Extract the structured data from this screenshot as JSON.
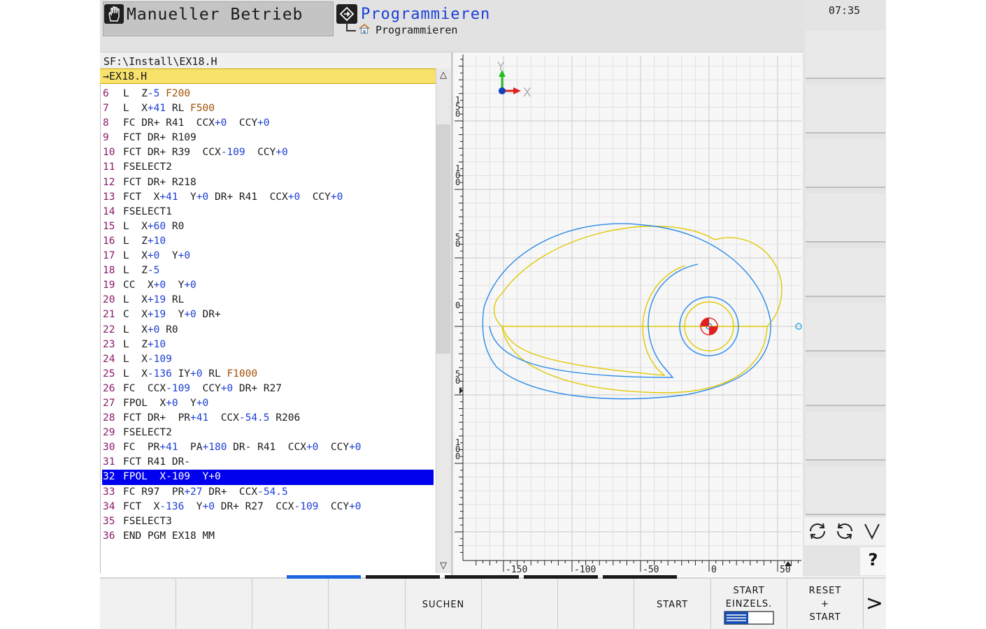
{
  "header": {
    "manual_mode": "Manueller Betrieb",
    "program_mode": "Programmieren",
    "program_submode": "Programmieren"
  },
  "clock": "07:35",
  "editor": {
    "path": "SF:\\Install\\EX18.H",
    "file": "→EX18.H",
    "lines": [
      {
        "no": "6",
        "text": "L  Z-5 F200"
      },
      {
        "no": "7",
        "text": "L  X+41 RL F500"
      },
      {
        "no": "8",
        "text": "FC DR+ R41  CCX+0  CCY+0"
      },
      {
        "no": "9",
        "text": "FCT DR+ R109"
      },
      {
        "no": "10",
        "text": "FCT DR+ R39  CCX-109  CCY+0"
      },
      {
        "no": "11",
        "text": "FSELECT2"
      },
      {
        "no": "12",
        "text": "FCT DR+ R218"
      },
      {
        "no": "13",
        "text": "FCT  X+41  Y+0 DR+ R41  CCX+0  CCY+0"
      },
      {
        "no": "14",
        "text": "FSELECT1"
      },
      {
        "no": "15",
        "text": "L  X+60 R0"
      },
      {
        "no": "16",
        "text": "L  Z+10"
      },
      {
        "no": "17",
        "text": "L  X+0  Y+0"
      },
      {
        "no": "18",
        "text": "L  Z-5"
      },
      {
        "no": "19",
        "text": "CC  X+0  Y+0"
      },
      {
        "no": "20",
        "text": "L  X+19 RL"
      },
      {
        "no": "21",
        "text": "C  X+19  Y+0 DR+"
      },
      {
        "no": "22",
        "text": "L  X+0 R0"
      },
      {
        "no": "23",
        "text": "L  Z+10"
      },
      {
        "no": "24",
        "text": "L  X-109"
      },
      {
        "no": "25",
        "text": "L  X-136 IY+0 RL F1000"
      },
      {
        "no": "26",
        "text": "FC  CCX-109  CCY+0 DR+ R27"
      },
      {
        "no": "27",
        "text": "FPOL  X+0  Y+0"
      },
      {
        "no": "28",
        "text": "FCT DR+  PR+41  CCX-54.5 R206"
      },
      {
        "no": "29",
        "text": "FSELECT2"
      },
      {
        "no": "30",
        "text": "FC  PR+41  PA+180 DR- R41  CCX+0  CCY+0"
      },
      {
        "no": "31",
        "text": "FCT R41 DR-"
      },
      {
        "no": "32",
        "text": "FPOL  X-109  Y+0"
      },
      {
        "no": "33",
        "text": "FC R97  PR+27 DR+  CCX-54.5"
      },
      {
        "no": "34",
        "text": "FCT  X-136  Y+0 DR+ R27  CCX-109  CCY+0"
      },
      {
        "no": "35",
        "text": "FSELECT3"
      },
      {
        "no": "36",
        "text": "END PGM EX18 MM"
      }
    ],
    "selected_line": "32"
  },
  "graphic": {
    "axis_x_label": "X",
    "axis_y_label": "Y",
    "x_ticks": [
      "-150",
      "-100",
      "-50",
      "0",
      "50"
    ],
    "y_ticks": [
      "150",
      "100",
      "50",
      "0",
      "50",
      "100"
    ],
    "contour_color": "#e0c800",
    "toolpath_color": "#2a8ae8"
  },
  "softkeys": {
    "suchen": "SUCHEN",
    "start": "START",
    "start_einzels_1": "START",
    "start_einzels_2": "EINZELS.",
    "reset_1": "RESET",
    "reset_2": "+",
    "reset_3": "START",
    "next": ">"
  },
  "side": {
    "help": "?"
  }
}
